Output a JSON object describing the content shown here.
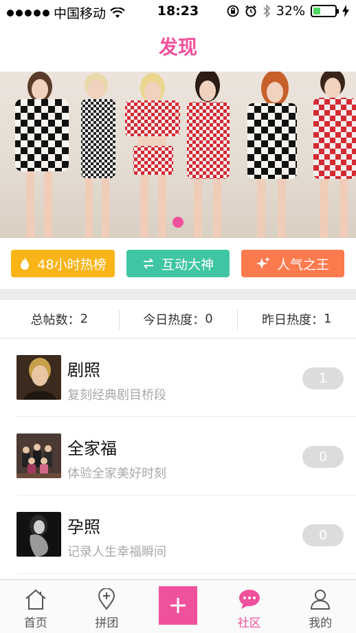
{
  "status_bar": {
    "carrier": "中国移动",
    "time": "18:23",
    "battery_percent": "32%",
    "battery_level": 0.32,
    "icons": [
      "signal-icon",
      "wifi-icon",
      "orientation-lock-icon",
      "alarm-icon",
      "bluetooth-icon",
      "battery-icon",
      "charging-icon"
    ]
  },
  "nav": {
    "title": "发现"
  },
  "banner": {
    "active_index": 0
  },
  "quick_buttons": [
    {
      "label": "48小时热榜",
      "icon": "flame-icon",
      "color": "#f9b418"
    },
    {
      "label": "互动大神",
      "icon": "swap-icon",
      "color": "#3fc5a3"
    },
    {
      "label": "人气之王",
      "icon": "sparkle-icon",
      "color": "#fb7a4e"
    }
  ],
  "stats": [
    {
      "label": "总帖数：",
      "value": "2"
    },
    {
      "label": "今日热度：",
      "value": "0"
    },
    {
      "label": "昨日热度：",
      "value": "1"
    }
  ],
  "categories": [
    {
      "title": "剧照",
      "subtitle": "复刻经典剧目桥段",
      "count": "1"
    },
    {
      "title": "全家福",
      "subtitle": "体验全家美好时刻",
      "count": "0"
    },
    {
      "title": "孕照",
      "subtitle": "记录人生幸福瞬间",
      "count": "0"
    }
  ],
  "tabbar": {
    "items": [
      {
        "label": "首页",
        "icon": "home-icon"
      },
      {
        "label": "拼团",
        "icon": "location-pin-icon"
      },
      {
        "label": "",
        "icon": "plus-icon"
      },
      {
        "label": "社区",
        "icon": "chat-bubble-icon"
      },
      {
        "label": "我的",
        "icon": "user-icon"
      }
    ],
    "active": "社区",
    "accent": "#f0519c"
  }
}
